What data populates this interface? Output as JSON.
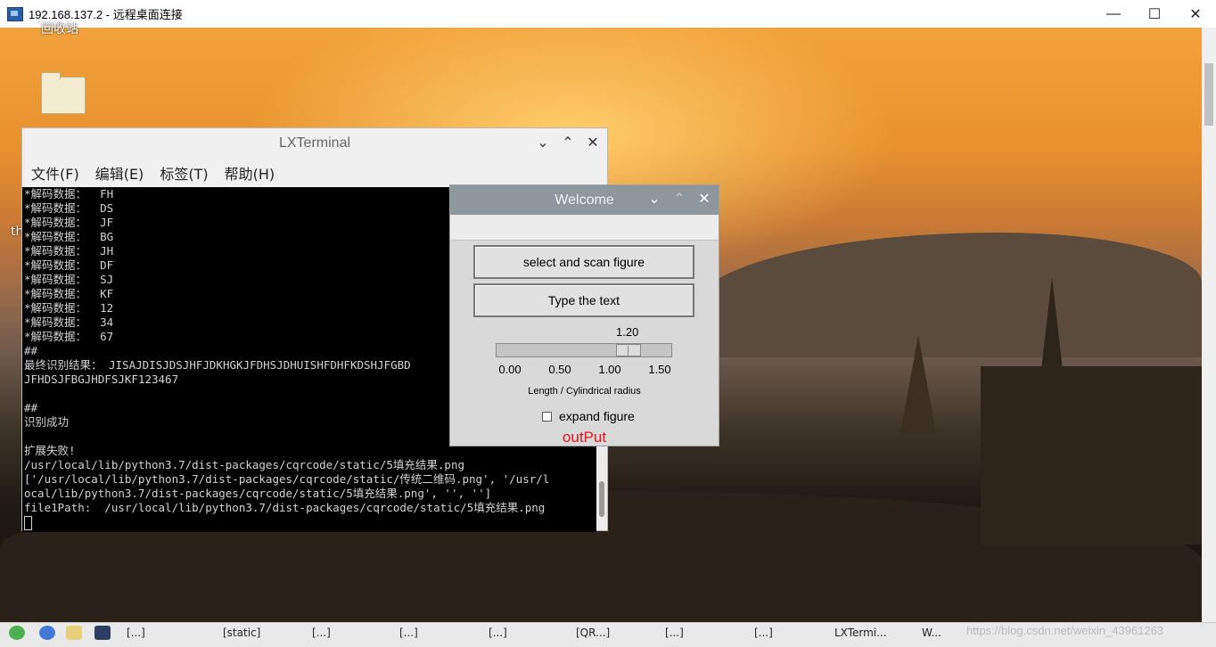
{
  "rdp": {
    "title": "192.168.137.2 - 远程桌面连接",
    "minimize": "—",
    "maximize": "☐",
    "close": "✕"
  },
  "desktop": {
    "trash_label": "回收站",
    "partial_label": "th"
  },
  "terminal": {
    "title": "LXTerminal",
    "menus": [
      "文件(F)",
      "编辑(E)",
      "标签(T)",
      "帮助(H)"
    ],
    "lines": [
      "*解码数据：  FH",
      "*解码数据：  DS",
      "*解码数据：  JF",
      "*解码数据：  BG",
      "*解码数据：  JH",
      "*解码数据：  DF",
      "*解码数据：  SJ",
      "*解码数据：  KF",
      "*解码数据：  12",
      "*解码数据：  34",
      "*解码数据：  67",
      "##",
      "最终识别结果： JISAJDISJDSJHFJDKHGKJFDHSJDHUISHFDHFKDSHJFGBD",
      "JFHDSJFBGJHDFSJKF123467",
      "",
      "##",
      "识别成功",
      "",
      "扩展失败!",
      "/usr/local/lib/python3.7/dist-packages/cqrcode/static/5填充结果.png",
      "['/usr/local/lib/python3.7/dist-packages/cqrcode/static/传统二维码.png', '/usr/l",
      "ocal/lib/python3.7/dist-packages/cqrcode/static/5填充结果.png', '', '']",
      "file1Path:  /usr/local/lib/python3.7/dist-packages/cqrcode/static/5填充结果.png"
    ]
  },
  "welcome": {
    "title": "Welcome",
    "select_button": "select and scan figure",
    "type_button": "Type the text",
    "slider_value": "1.20",
    "slider_fraction": 0.8,
    "ticks": [
      "0.00",
      "0.50",
      "1.00",
      "1.50"
    ],
    "slider_label": "Length / Cylindrical radius",
    "checkbox_label": "expand figure",
    "checkbox_checked": false,
    "output_label": "outPut",
    "output_color": "#e0141a"
  },
  "taskbar": {
    "items": [
      "[...]",
      "[static]",
      "[...]",
      "[...]",
      "[...]",
      "[QR...]",
      "[...]",
      "[...]",
      "LXTermi...",
      "W..."
    ],
    "watermark": "https://blog.csdn.net/weixin_43961263"
  }
}
